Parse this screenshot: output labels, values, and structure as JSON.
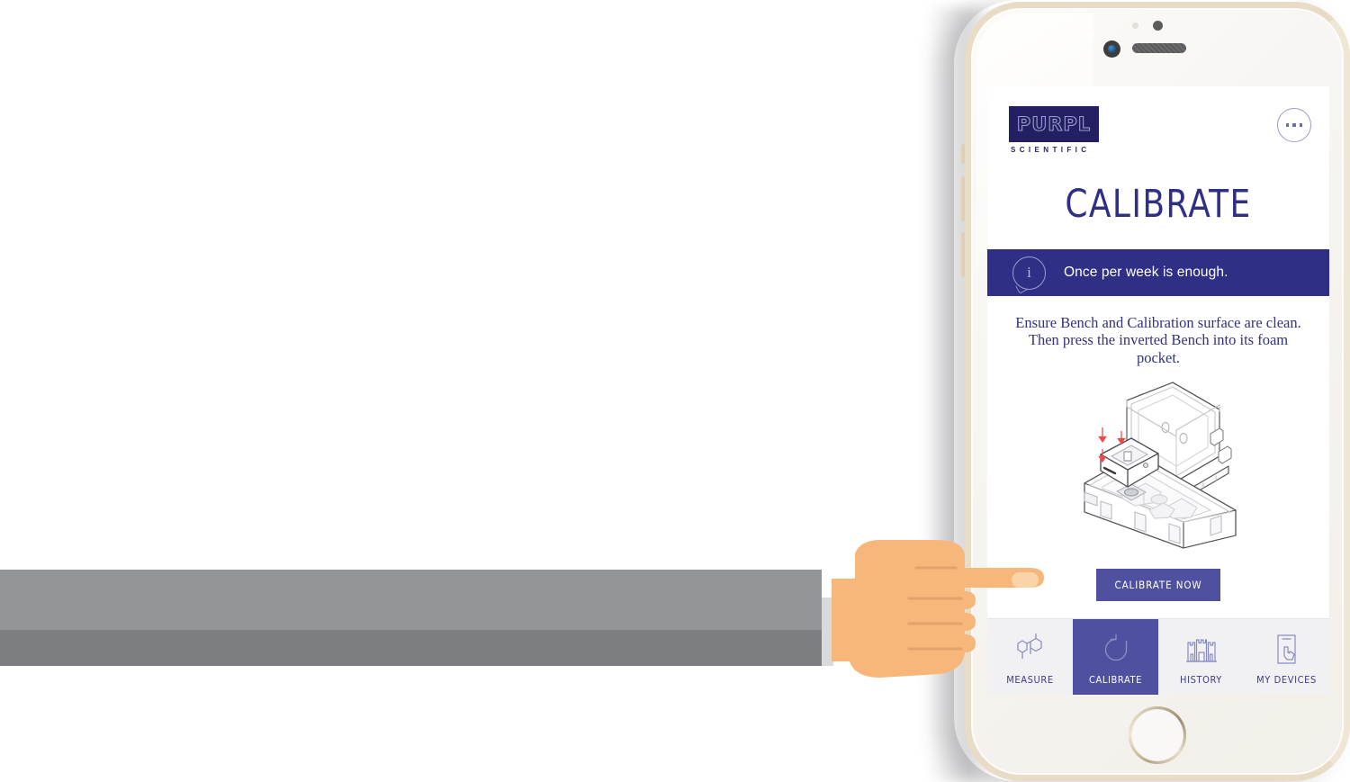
{
  "app": {
    "brand": {
      "name": "PURPL",
      "tagline": "SCIENTIFIC"
    },
    "more_menu_label": "more-options",
    "page_title": "CALIBRATE"
  },
  "info_banner": {
    "icon": "info-bubble-icon",
    "text": "Once per week is enough."
  },
  "instructions": {
    "text": "Ensure Bench and Calibration surface are clean.  Then press the inverted Bench into its foam pocket."
  },
  "illustration": {
    "name": "calibration-case-illustration",
    "description": "Open hard carry case with inverted Bench device being pressed into foam pocket",
    "arrow_color": "#ee4a4a",
    "line_color": "#4a4a4a"
  },
  "primary_action": {
    "label": "CALIBRATE NOW",
    "color": "#4f50a0"
  },
  "tabbar": {
    "items": [
      {
        "id": "measure",
        "label": "MEASURE",
        "icon": "molecule-icon",
        "active": false
      },
      {
        "id": "calibrate",
        "label": "CALIBRATE",
        "icon": "refresh-arrow-icon",
        "active": true
      },
      {
        "id": "history",
        "label": "HISTORY",
        "icon": "castle-chart-icon",
        "active": false
      },
      {
        "id": "my-devices",
        "label": "MY DEVICES",
        "icon": "device-hand-icon",
        "active": false
      }
    ]
  },
  "cursor": {
    "name": "pointing-hand-cursor",
    "skin_color": "#f7b77b",
    "highlight_color": "#fbd3a8"
  },
  "decor": {
    "bar_light_color": "#939598",
    "bar_dark_color": "#7d7e81",
    "cuff_color": "#d9dadb"
  },
  "theme": {
    "navy": "#241f63",
    "indigo": "#2f2f86",
    "accent": "#4f50a0",
    "tab_bg": "#f1f1f3",
    "phone_frame": "#e8dcc6"
  }
}
